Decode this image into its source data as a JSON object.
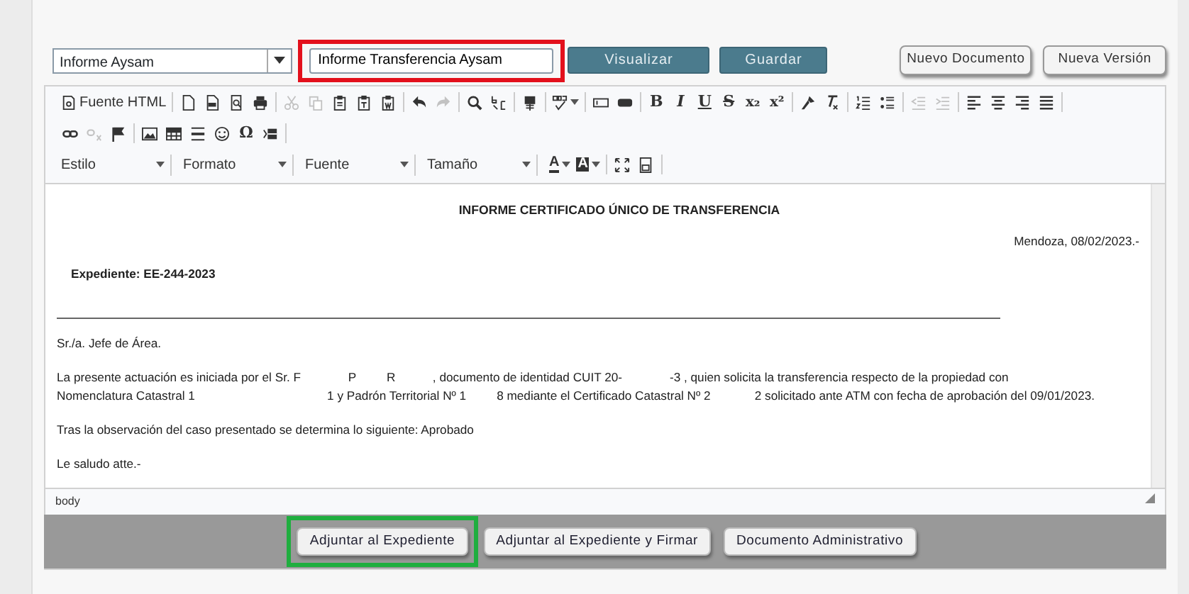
{
  "template_select": {
    "value": "Informe Aysam"
  },
  "title_field": {
    "value": "Informe Transferencia Aysam",
    "highlighted": true
  },
  "actions": [
    {
      "label": "Visualizar",
      "kind": "primary"
    },
    {
      "label": "Guardar",
      "kind": "primary"
    },
    {
      "label": "Nuevo Documento",
      "kind": "secondary"
    },
    {
      "label": "Nueva Versión",
      "kind": "secondary"
    }
  ],
  "toolbar": {
    "rows": [
      [
        [
          {
            "kind": "text",
            "label": "Fuente HTML"
          }
        ],
        [
          {
            "kind": "icon",
            "disabled": false
          },
          {
            "kind": "icon",
            "disabled": false
          },
          {
            "kind": "icon",
            "disabled": false
          },
          {
            "kind": "icon",
            "disabled": false
          }
        ],
        [
          {
            "kind": "icon",
            "disabled": true
          },
          {
            "kind": "icon",
            "disabled": true
          },
          {
            "kind": "icon",
            "disabled": false
          },
          {
            "kind": "icon",
            "disabled": false
          },
          {
            "kind": "icon",
            "disabled": false
          }
        ],
        [
          {
            "kind": "icon",
            "disabled": false
          },
          {
            "kind": "icon",
            "disabled": true
          }
        ],
        [
          {
            "kind": "icon",
            "disabled": false
          },
          {
            "kind": "icon",
            "disabled": false
          }
        ],
        [
          {
            "kind": "icon",
            "disabled": false
          }
        ],
        [
          {
            "kind": "icon",
            "disabled": false,
            "dropdown": true
          }
        ],
        [
          {
            "kind": "icon",
            "disabled": false
          },
          {
            "kind": "icon",
            "disabled": false
          }
        ],
        [
          {
            "kind": "glyph",
            "glyph": "B",
            "disabled": false
          },
          {
            "kind": "glyph",
            "glyph": "I",
            "disabled": false
          },
          {
            "kind": "glyph",
            "glyph": "U",
            "disabled": false
          },
          {
            "kind": "glyph",
            "glyph": "S",
            "disabled": false
          },
          {
            "kind": "glyph",
            "glyph": "x₂",
            "disabled": false
          },
          {
            "kind": "glyph",
            "glyph": "x²",
            "disabled": false
          }
        ],
        [
          {
            "kind": "icon",
            "disabled": false
          },
          {
            "kind": "icon",
            "disabled": false
          }
        ],
        [
          {
            "kind": "icon",
            "disabled": false
          },
          {
            "kind": "icon",
            "disabled": false
          }
        ],
        [
          {
            "kind": "icon",
            "disabled": true
          },
          {
            "kind": "icon",
            "disabled": true
          }
        ],
        [
          {
            "kind": "icon",
            "disabled": false
          },
          {
            "kind": "icon",
            "disabled": false
          },
          {
            "kind": "icon",
            "disabled": false
          },
          {
            "kind": "icon",
            "disabled": false
          }
        ]
      ],
      [
        [
          {
            "kind": "icon",
            "disabled": false
          },
          {
            "kind": "icon",
            "disabled": true
          },
          {
            "kind": "icon",
            "disabled": false
          }
        ],
        [
          {
            "kind": "icon",
            "disabled": false
          },
          {
            "kind": "icon",
            "disabled": false
          },
          {
            "kind": "icon",
            "disabled": false
          },
          {
            "kind": "icon",
            "disabled": false
          },
          {
            "kind": "glyph",
            "glyph": "Ω",
            "disabled": false
          },
          {
            "kind": "icon",
            "disabled": false
          }
        ]
      ],
      [
        [
          {
            "kind": "combo",
            "label": "Estilo"
          },
          {
            "kind": "combo",
            "label": "Formato"
          },
          {
            "kind": "combo",
            "label": "Fuente"
          },
          {
            "kind": "combo",
            "label": "Tamaño"
          }
        ],
        [
          {
            "kind": "color",
            "glyph": "A",
            "filled": false
          },
          {
            "kind": "color",
            "glyph": "A",
            "filled": true
          }
        ],
        [
          {
            "kind": "icon",
            "disabled": false
          },
          {
            "kind": "icon",
            "disabled": false
          }
        ]
      ]
    ]
  },
  "document": {
    "title": "INFORME CERTIFICADO ÚNICO DE TRANSFERENCIA",
    "date": "Mendoza, 08/02/2023.-",
    "file_number": "Expediente: EE-244-2023",
    "paragraphs": [
      {
        "lines": [
          "Sr./a. Jefe de Área."
        ]
      },
      {
        "lines": [
          "La presente actuación es iniciada por el Sr. F              P         R           , documento de identidad CUIT 20-              -3 , quien solicita la transferencia respecto de la propiedad con",
          "Nomenclatura Catastral 1                                       1 y Padrón Territorial Nº 1         8 mediante el Certificado Catastral Nº 2             2 solicitado ante ATM con fecha de aprobación del 09/01/2023."
        ]
      },
      {
        "lines": [
          "Tras la observación del caso presentado se determina lo siguiente: Aprobado"
        ]
      },
      {
        "lines": [
          "Le saludo atte.-"
        ]
      }
    ]
  },
  "status_bar": {
    "path": "body"
  },
  "footer_buttons": [
    {
      "label": "Adjuntar al Expediente",
      "highlighted": true
    },
    {
      "label": "Adjuntar al Expediente y Firmar"
    },
    {
      "label": "Documento Administrativo"
    }
  ]
}
